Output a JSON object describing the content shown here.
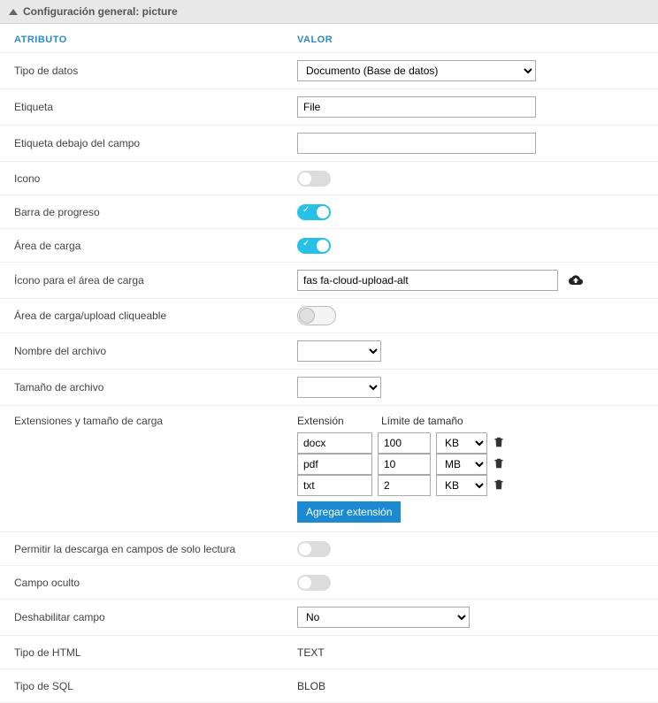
{
  "panel": {
    "title": "Configuración general: picture"
  },
  "headers": {
    "attribute": "ATRIBUTO",
    "value": "VALOR"
  },
  "rows": {
    "dataType": {
      "label": "Tipo de datos",
      "value": "Documento (Base de datos)"
    },
    "etiqueta": {
      "label": "Etiqueta",
      "value": "File"
    },
    "etiquetaDebajo": {
      "label": "Etiqueta debajo del campo",
      "value": ""
    },
    "icono": {
      "label": "Icono"
    },
    "barraProgreso": {
      "label": "Barra de progreso"
    },
    "areaCarga": {
      "label": "Área de carga"
    },
    "iconoArea": {
      "label": "Ícono para el área de carga",
      "value": "fas fa-cloud-upload-alt"
    },
    "areaClick": {
      "label": "Área de carga/upload cliqueable"
    },
    "nombreArchivo": {
      "label": "Nombre del archivo"
    },
    "tamanoArchivo": {
      "label": "Tamaño de archivo"
    },
    "extensiones": {
      "label": "Extensiones y tamaño de carga",
      "hExt": "Extensión",
      "hLim": "Límite de tamaño",
      "items": [
        {
          "ext": "docx",
          "limit": "100",
          "unit": "KB"
        },
        {
          "ext": "pdf",
          "limit": "10",
          "unit": "MB"
        },
        {
          "ext": "txt",
          "limit": "2",
          "unit": "KB"
        }
      ],
      "addBtn": "Agregar extensión"
    },
    "permitirDescarga": {
      "label": "Permitir la descarga en campos de solo lectura"
    },
    "campoOculto": {
      "label": "Campo oculto"
    },
    "deshabilitar": {
      "label": "Deshabilitar campo",
      "value": "No"
    },
    "tipoHtml": {
      "label": "Tipo de HTML",
      "value": "TEXT"
    },
    "tipoSql": {
      "label": "Tipo de SQL",
      "value": "BLOB"
    }
  }
}
